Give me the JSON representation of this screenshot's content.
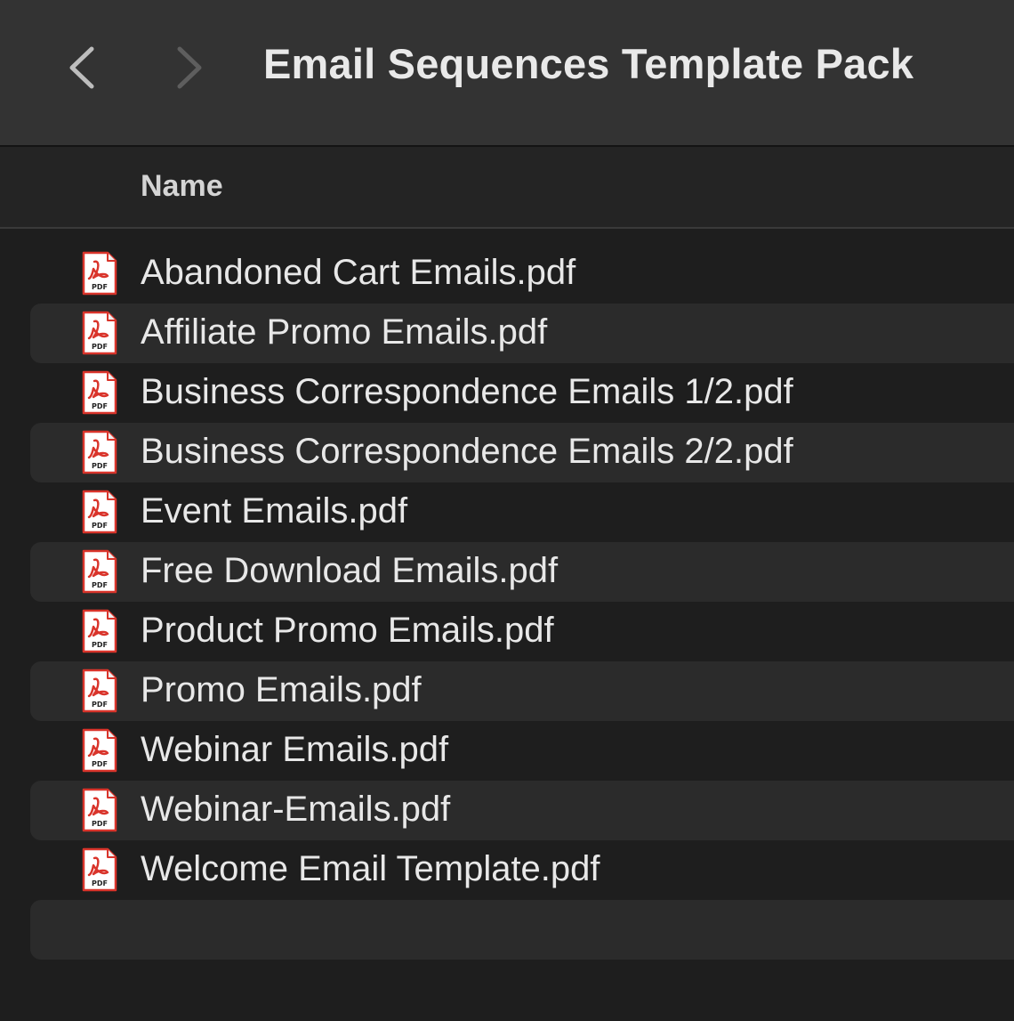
{
  "window": {
    "title": "Email Sequences Template Pack"
  },
  "icons": {
    "back": "chevron-left-icon",
    "forward": "chevron-right-icon",
    "file": "pdf-file-icon"
  },
  "columns": {
    "name": "Name"
  },
  "pdf_icon_label": "PDF",
  "files": [
    {
      "name": "Abandoned Cart Emails.pdf"
    },
    {
      "name": "Affiliate Promo Emails.pdf"
    },
    {
      "name": "Business Correspondence Emails 1/2.pdf"
    },
    {
      "name": "Business Correspondence Emails 2/2.pdf"
    },
    {
      "name": "Event Emails.pdf"
    },
    {
      "name": "Free Download Emails.pdf"
    },
    {
      "name": "Product Promo Emails.pdf"
    },
    {
      "name": "Promo Emails.pdf"
    },
    {
      "name": "Webinar Emails.pdf"
    },
    {
      "name": "Webinar-Emails.pdf"
    },
    {
      "name": "Welcome Email Template.pdf"
    }
  ],
  "colors": {
    "background": "#1e1e1e",
    "titlebar": "#333333",
    "row_alt": "#2b2b2b",
    "pdf_red": "#d9342b"
  }
}
